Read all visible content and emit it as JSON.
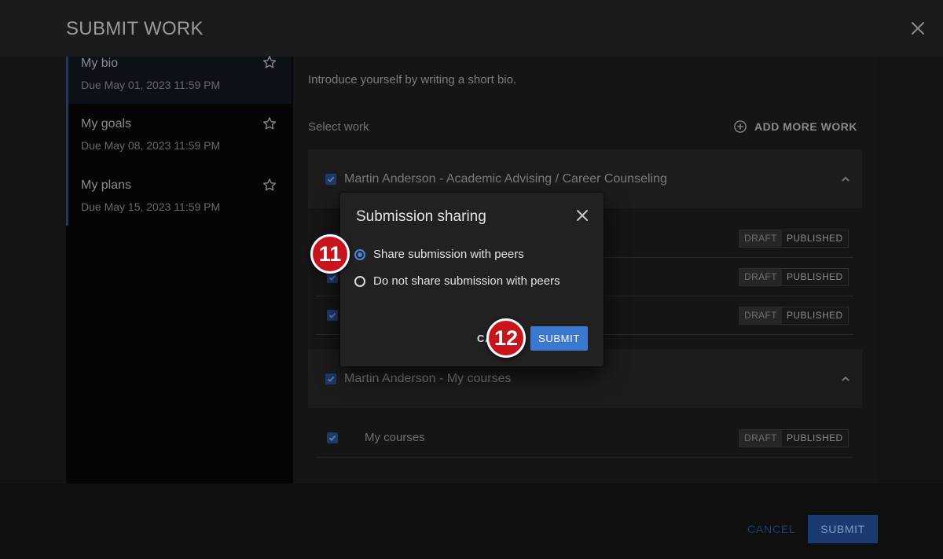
{
  "header": {
    "title": "SUBMIT WORK",
    "close_icon": "close-icon"
  },
  "sidebar": {
    "items": [
      {
        "title": "My bio",
        "due": "Due May 01, 2023 11:59 PM",
        "active": true
      },
      {
        "title": "My goals",
        "due": "Due May 08, 2023 11:59 PM",
        "active": false
      },
      {
        "title": "My plans",
        "due": "Due May 15, 2023 11:59 PM",
        "active": false
      }
    ]
  },
  "main": {
    "intro": "Introduce yourself by writing a short bio.",
    "select_label": "Select work",
    "add_more_label": "ADD MORE WORK",
    "groups": [
      {
        "title": "Martin Anderson - Academic Advising / Career Counseling"
      },
      {
        "title": "Martin Anderson - My courses",
        "rows": [
          {
            "title": "My courses"
          }
        ]
      }
    ],
    "status": {
      "draft": "DRAFT",
      "published": "PUBLISHED"
    }
  },
  "footer": {
    "cancel_label": "CANCEL",
    "submit_label": "SUBMIT"
  },
  "dialog": {
    "title": "Submission sharing",
    "options": [
      {
        "label": "Share submission with peers",
        "selected": true
      },
      {
        "label": "Do not share submission with peers",
        "selected": false
      }
    ],
    "cancel_label": "CA",
    "submit_label": "SUBMIT"
  },
  "steps": [
    "11",
    "12"
  ],
  "colors": {
    "accent": "#3b78d0",
    "step_badge": "#c8141d",
    "background": "#141414"
  }
}
